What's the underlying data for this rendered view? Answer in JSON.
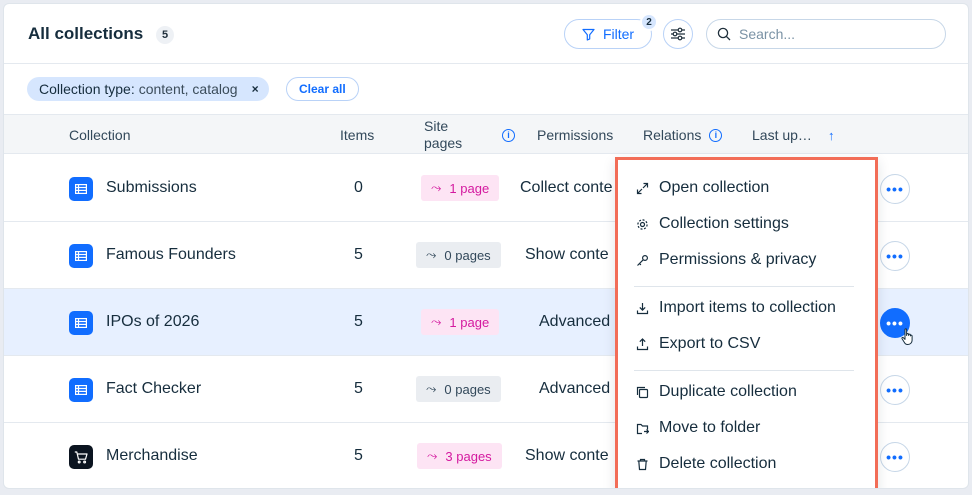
{
  "header": {
    "title": "All collections",
    "count": "5",
    "filter_label": "Filter",
    "filter_count": "2",
    "search_placeholder": "Search..."
  },
  "filters": {
    "chip_key": "Collection type:",
    "chip_value": "content, catalog",
    "chip_remove": "×",
    "clear_all": "Clear all"
  },
  "table": {
    "columns": {
      "collection": "Collection",
      "items": "Items",
      "site_pages": "Site pages",
      "permissions": "Permissions",
      "relations": "Relations",
      "last_updated": "Last up…",
      "sort_arrow": "↑"
    },
    "rows": [
      {
        "name": "Submissions",
        "items": "0",
        "pages": "1 page",
        "perm": "Collect conte",
        "more": "•••"
      },
      {
        "name": "Famous Founders",
        "items": "5",
        "pages": "0 pages",
        "perm": "Show conte",
        "more": "•••"
      },
      {
        "name": "IPOs of 2026",
        "items": "5",
        "pages": "1 page",
        "perm": "Advanced",
        "more": "•••"
      },
      {
        "name": "Fact Checker",
        "items": "5",
        "pages": "0 pages",
        "perm": "Advanced",
        "more": "•••"
      },
      {
        "name": "Merchandise",
        "items": "5",
        "pages": "3 pages",
        "perm": "Show conte",
        "more": "•••"
      }
    ]
  },
  "menu": {
    "items": [
      {
        "label": "Open collection",
        "icon": "expand-icon"
      },
      {
        "label": "Collection settings",
        "icon": "gear-icon"
      },
      {
        "label": "Permissions & privacy",
        "icon": "key-icon"
      },
      {
        "label": "Import items to collection",
        "icon": "import-icon"
      },
      {
        "label": "Export to CSV",
        "icon": "export-icon"
      },
      {
        "label": "Duplicate collection",
        "icon": "duplicate-icon"
      },
      {
        "label": "Move to folder",
        "icon": "move-folder-icon"
      },
      {
        "label": "Delete collection",
        "icon": "trash-icon"
      }
    ]
  },
  "colors": {
    "accent": "#116dff",
    "pink_pill_bg": "#fde4f4",
    "pink_pill_text": "#d4199f",
    "menu_highlight_border": "#f26d57",
    "selected_row_bg": "#e7f0ff"
  }
}
